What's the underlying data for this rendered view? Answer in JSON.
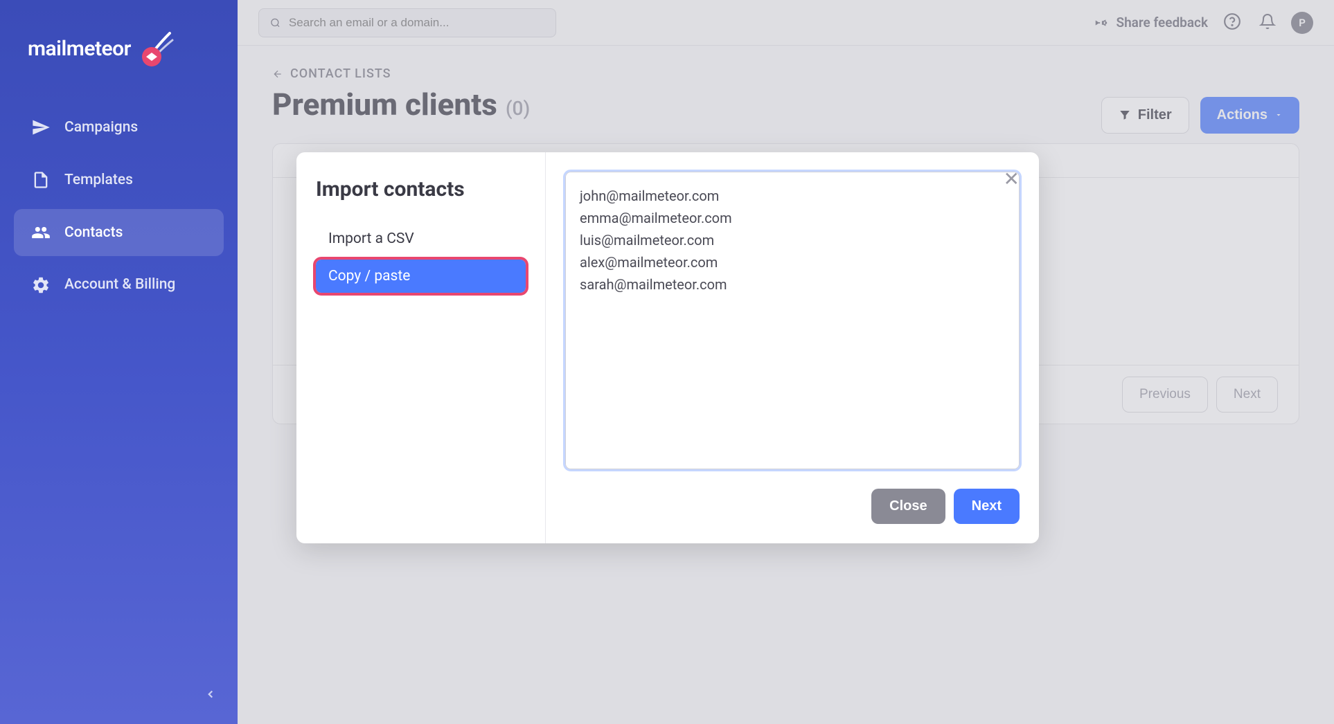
{
  "brand": "mailmeteor",
  "sidebar": {
    "items": [
      {
        "label": "Campaigns"
      },
      {
        "label": "Templates"
      },
      {
        "label": "Contacts"
      },
      {
        "label": "Account & Billing"
      }
    ]
  },
  "topbar": {
    "search_placeholder": "Search an email or a domain...",
    "share_feedback": "Share feedback",
    "avatar_initial": "P"
  },
  "page": {
    "breadcrumb": "CONTACT LISTS",
    "title": "Premium clients",
    "count": "(0)",
    "filter_label": "Filter",
    "actions_label": "Actions",
    "previous_label": "Previous",
    "next_label": "Next"
  },
  "modal": {
    "title": "Import contacts",
    "nav": [
      {
        "label": "Import a CSV"
      },
      {
        "label": "Copy / paste"
      }
    ],
    "textarea_value": "john@mailmeteor.com\nemma@mailmeteor.com\nluis@mailmeteor.com\nalex@mailmeteor.com\nsarah@mailmeteor.com",
    "close_label": "Close",
    "next_label": "Next"
  }
}
